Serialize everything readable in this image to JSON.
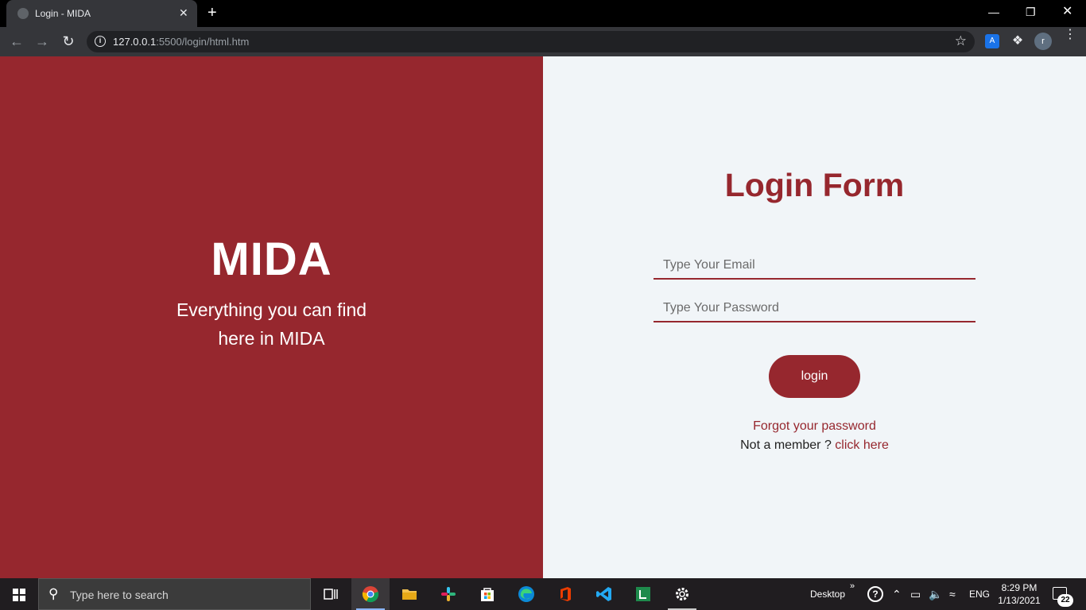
{
  "browser": {
    "tab_title": "Login - MIDA",
    "tab_close": "✕",
    "new_tab": "+",
    "url_host": "127.0.0.1",
    "url_path": ":5500/login/html.htm",
    "profile_initial": "r",
    "window_controls": {
      "minimize": "—",
      "maximize": "❐",
      "close": "✕"
    }
  },
  "left_panel": {
    "brand": "MIDA",
    "tagline_line1": "Everything you can find",
    "tagline_line2": "here in MIDA",
    "background_color": "#96272e"
  },
  "login_form": {
    "title": "Login Form",
    "email_placeholder": "Type Your Email",
    "password_placeholder": "Type Your Password",
    "submit_label": "login",
    "forgot_password": "Forgot your password",
    "member_prompt": "Not a member ?",
    "signup_link": "click here",
    "accent_color": "#96272e",
    "background_color": "#f1f5f8"
  },
  "taskbar": {
    "search_placeholder": "Type here to search",
    "desktop_label": "Desktop",
    "overflow_chevron": "»",
    "language": "ENG",
    "time": "8:29 PM",
    "date": "1/13/2021",
    "notification_count": "22",
    "pinned_apps": [
      "task-view",
      "chrome",
      "file-explorer",
      "slack",
      "microsoft-store",
      "edge",
      "office",
      "vscode",
      "terminal-app",
      "settings"
    ]
  }
}
